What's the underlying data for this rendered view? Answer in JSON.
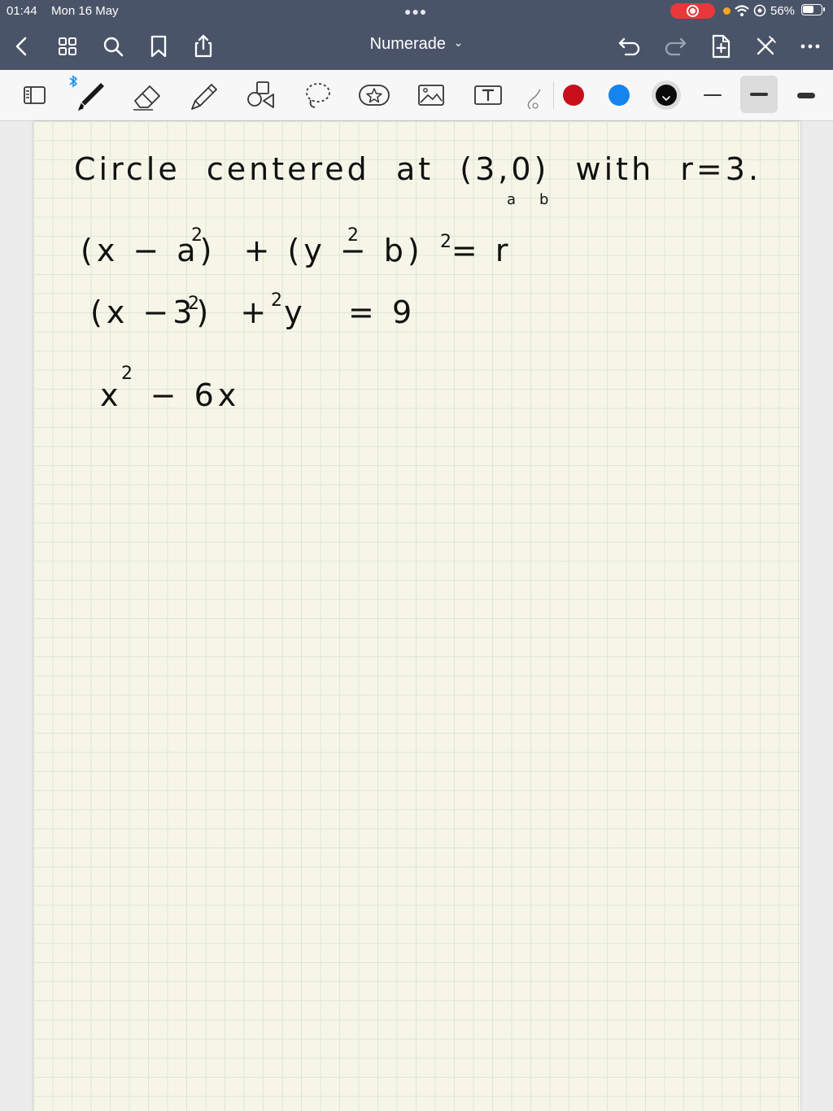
{
  "status_bar": {
    "time": "01:44",
    "date": "Mon 16 May",
    "multitask_icon": "three-dots",
    "battery_percent": "56%",
    "icons": [
      "screen-record-icon",
      "orange-dot",
      "wifi-icon",
      "location-icon",
      "battery-icon"
    ]
  },
  "nav_bar": {
    "title": "Numerade",
    "title_chevron": "⌄",
    "left_icons": [
      "back-chevron-icon",
      "grid-icon",
      "search-icon",
      "bookmark-icon",
      "share-icon"
    ],
    "right_icons": [
      "undo-icon",
      "redo-icon",
      "add-page-icon",
      "close-icon",
      "more-icon"
    ]
  },
  "toolbar": {
    "tools": [
      "sidebar-toggle-icon",
      "pen-icon",
      "eraser-icon",
      "highlighter-icon",
      "shapes-icon",
      "lasso-icon",
      "sticker-icon",
      "image-icon",
      "text-icon",
      "laser-icon"
    ],
    "colors": [
      "#c8101c",
      "#1485ee",
      "#0a0a0a"
    ],
    "selected_color": "#0a0a0a",
    "thickness": [
      "thin",
      "medium",
      "thick"
    ],
    "selected_thickness": "medium"
  },
  "note": {
    "line1": "Circle  centered  at  (3,0)  with  r=3.",
    "line1_sub_a": "a",
    "line1_sub_b": "b",
    "line2": "(x − a)  + (y − b)  = r",
    "line2_exp1": "2",
    "line2_exp2": "2",
    "line2_exp3": "2",
    "line3": "(x −3)  + y   = 9",
    "line3_exp1": "2",
    "line3_exp2": "2",
    "line4": "x  − 6x",
    "line4_exp": "2"
  }
}
